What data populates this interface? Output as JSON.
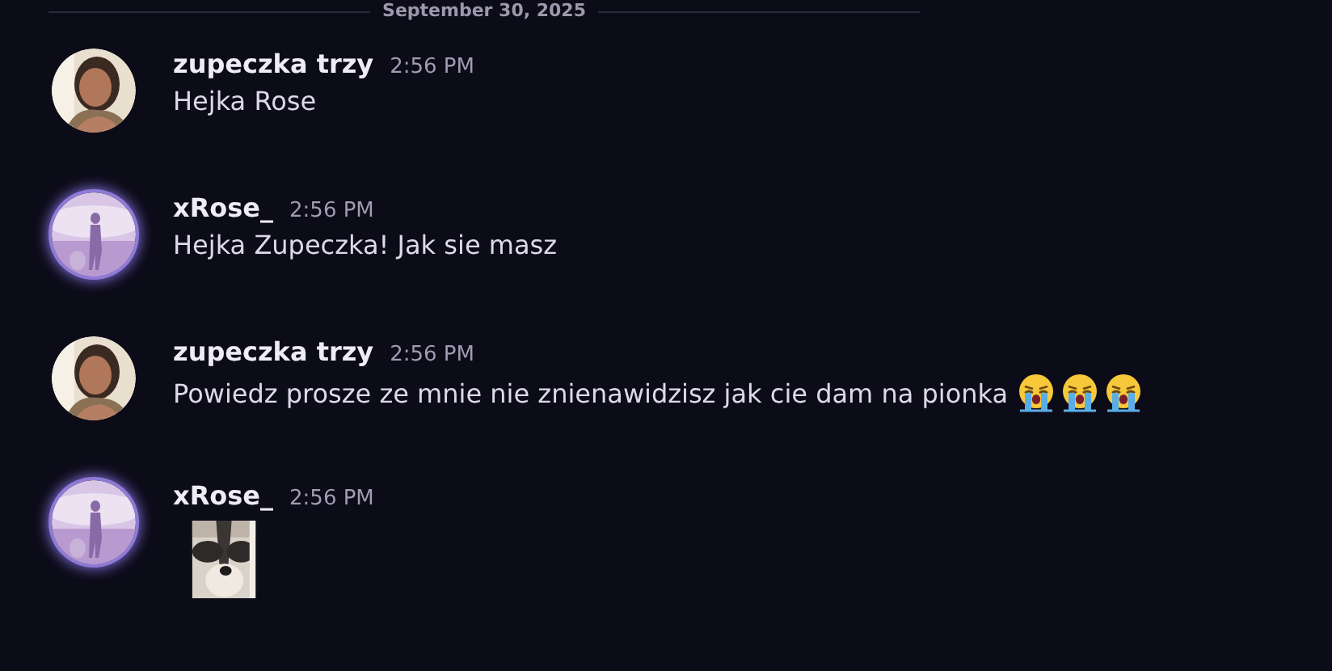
{
  "divider": {
    "date": "September 30, 2025"
  },
  "messages": [
    {
      "author": "zupeczka trzy",
      "time": "2:56 PM",
      "avatar_decoration": false,
      "kind": "text",
      "text": "Hejka Rose"
    },
    {
      "author": "xRose_",
      "time": "2:56 PM",
      "avatar_decoration": true,
      "kind": "text",
      "text": "Hejka Zupeczka! Jak sie masz"
    },
    {
      "author": "zupeczka trzy",
      "time": "2:56 PM",
      "avatar_decoration": false,
      "kind": "text",
      "text": "Powiedz prosze ze mnie nie znienawidzisz jak cie dam na pionka",
      "emojis": [
        {
          "kind": "crying"
        },
        {
          "kind": "crying"
        },
        {
          "kind": "crying"
        }
      ]
    },
    {
      "author": "xRose_",
      "time": "2:56 PM",
      "avatar_decoration": true,
      "kind": "sticker"
    }
  ]
}
